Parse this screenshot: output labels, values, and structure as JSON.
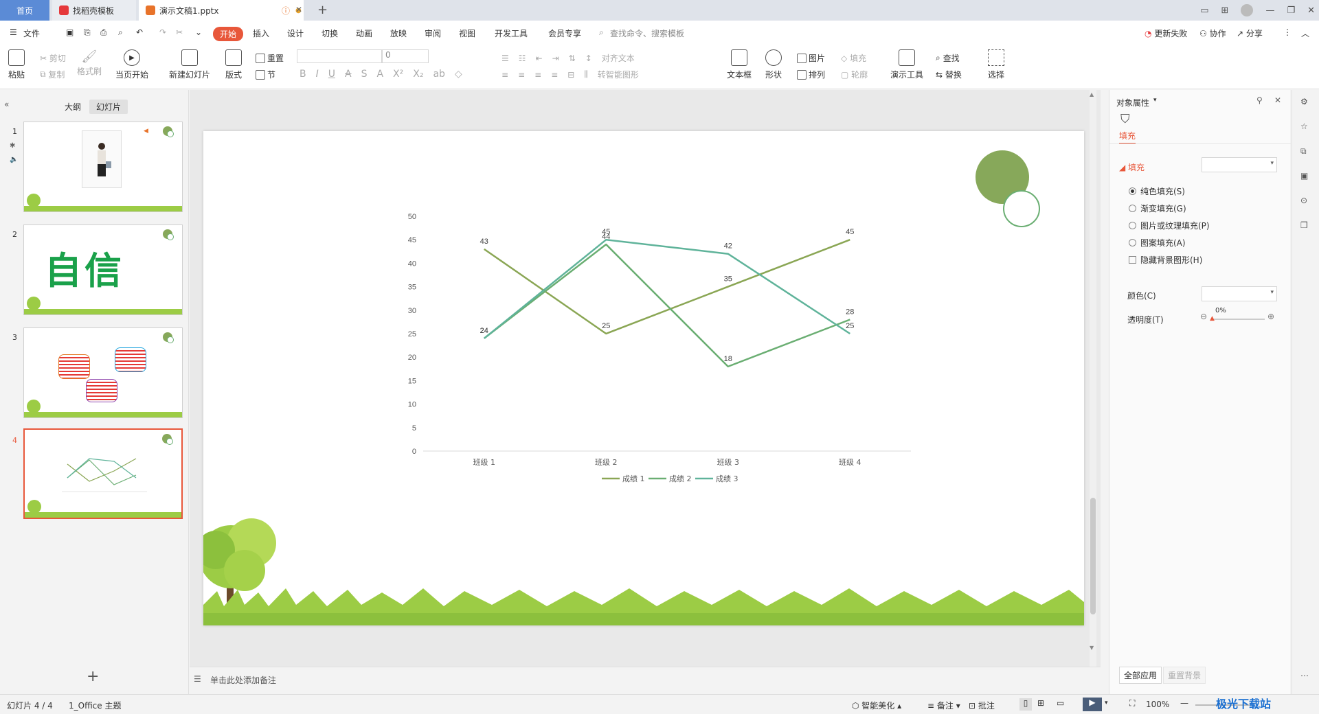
{
  "titlebar": {
    "tabs": [
      {
        "label": "首页"
      },
      {
        "label": "找稻壳模板"
      },
      {
        "label": "演示文稿1.pptx"
      }
    ]
  },
  "menu": {
    "file": "文件",
    "items": [
      "开始",
      "插入",
      "设计",
      "切换",
      "动画",
      "放映",
      "审阅",
      "视图",
      "开发工具",
      "会员专享"
    ],
    "search_placeholder": "查找命令、搜索模板",
    "update_failed": "更新失败",
    "collaborate": "协作",
    "share": "分享"
  },
  "ribbon": {
    "paste": "粘贴",
    "cut": "剪切",
    "copy": "复制",
    "format_painter": "格式刷",
    "from_current": "当页开始",
    "new_slide": "新建幻灯片",
    "layout": "版式",
    "reset": "重置",
    "section": "节",
    "font_size": "0",
    "align_text": "对齐文本",
    "smart_shape": "转智能图形",
    "textbox": "文本框",
    "shape": "形状",
    "picture": "图片",
    "arrange": "排列",
    "fill": "填充",
    "outline": "轮廓",
    "present_tools": "演示工具",
    "find": "查找",
    "replace": "替换",
    "select": "选择"
  },
  "leftpanel": {
    "outline_tab": "大纲",
    "slides_tab": "幻灯片",
    "slide_numbers": [
      "1",
      "2",
      "3",
      "4"
    ],
    "slide2_text": "自信"
  },
  "notes": {
    "placeholder": "单击此处添加备注"
  },
  "rightpanel": {
    "title": "对象属性",
    "fill_tab": "填充",
    "fill_section": "填充",
    "options": [
      "纯色填充(S)",
      "渐变填充(G)",
      "图片或纹理填充(P)",
      "图案填充(A)"
    ],
    "hide_bg": "隐藏背景图形(H)",
    "color_label": "颜色(C)",
    "transparency_label": "透明度(T)",
    "transparency_value": "0%",
    "apply_all": "全部应用",
    "reset_bg": "重置背景"
  },
  "statusbar": {
    "slide_pos": "幻灯片 4 / 4",
    "theme": "1_Office 主题",
    "beautify": "智能美化",
    "notes": "备注",
    "comments": "批注",
    "zoom": "100%"
  },
  "watermark": "极光下载站",
  "colors": {
    "accent": "#e8573a",
    "series1": "#8aa654",
    "series2": "#6aae72",
    "series3": "#5fb39a",
    "circle": "#87a85a"
  },
  "chart_data": {
    "type": "line",
    "categories": [
      "班级 1",
      "班级 2",
      "班级 3",
      "班级 4"
    ],
    "series": [
      {
        "name": "成绩 1",
        "values": [
          43,
          25,
          35,
          45
        ]
      },
      {
        "name": "成绩 2",
        "values": [
          24,
          44,
          18,
          28
        ]
      },
      {
        "name": "成绩 3",
        "values": [
          24,
          45,
          42,
          25
        ]
      }
    ],
    "ylim": [
      0,
      50
    ],
    "yticks": [
      0,
      5,
      10,
      15,
      20,
      25,
      30,
      35,
      40,
      45,
      50
    ],
    "legend": "bottom",
    "grid": false,
    "data_labels": true
  }
}
